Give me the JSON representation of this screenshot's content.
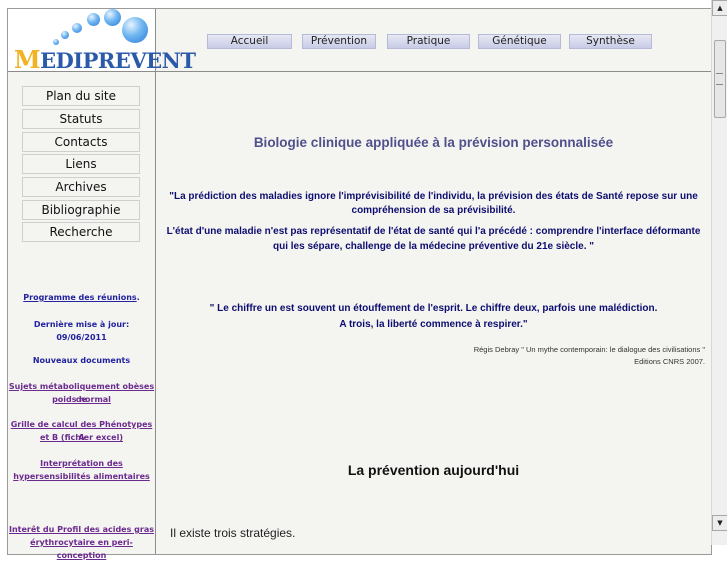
{
  "logo": {
    "prefix": "M",
    "text": "EDIPREVENT"
  },
  "nav": [
    {
      "label": "Accueil"
    },
    {
      "label": "Prévention"
    },
    {
      "label": "Pratique"
    },
    {
      "label": "Génétique"
    },
    {
      "label": "Synthèse"
    }
  ],
  "sidebar": {
    "items": [
      {
        "label": "Plan du site"
      },
      {
        "label": "Statuts"
      },
      {
        "label": "Contacts"
      },
      {
        "label": "Liens"
      },
      {
        "label": "Archives"
      },
      {
        "label": "Bibliographie"
      },
      {
        "label": "Recherche"
      }
    ],
    "programme": "Programme des réunions",
    "programme_suffix": ".",
    "last_update_label": "Dernière mise à jour:",
    "last_update_date": "09/06/2011",
    "new_docs": "Nouveaux documents",
    "doc1_line1": "Sujets métaboliquement obèses de",
    "doc1_line2": "poids normal",
    "doc2_line1": "Grille de calcul des Phénotypes A",
    "doc2_line2": "et B (fichier excel)",
    "doc3_line1": "Interprétation des",
    "doc3_line2": "hypersensibilités alimentaires",
    "doc4_line1": "Interêt du Profil des acides gras",
    "doc4_line2": "érythrocytaire en peri-conception"
  },
  "content": {
    "title": "Biologie clinique appliquée à la prévision personnalisée",
    "quote1_line1": "\"La prédiction des maladies ignore l'imprévisibilité de l'individu, la prévision des états de Santé repose sur une",
    "quote1_line2": "compréhension de sa prévisibilité.",
    "quote2_line1": "L'état d'une maladie n'est pas représentatif de l'état de santé qui l'a précédé : comprendre l'interface déformante",
    "quote2_line2": "qui les sépare, challenge de la médecine préventive du 21e siècle. \"",
    "quote3_line1": "\" Le chiffre un est souvent un étouffement de l'esprit. Le chiffre deux, parfois une malédiction.",
    "quote3_line2": "A trois, la liberté commence à respirer.\"",
    "attrib_line1": "Régis Debray \" Un mythe contemporain: le dialogue des civilisations \"",
    "attrib_line2": "Editions CNRS 2007.",
    "section_title": "La prévention aujourd'hui",
    "body_text": "Il existe trois stratégies."
  },
  "scrollbar": {
    "up": "▲",
    "down": "▼"
  }
}
